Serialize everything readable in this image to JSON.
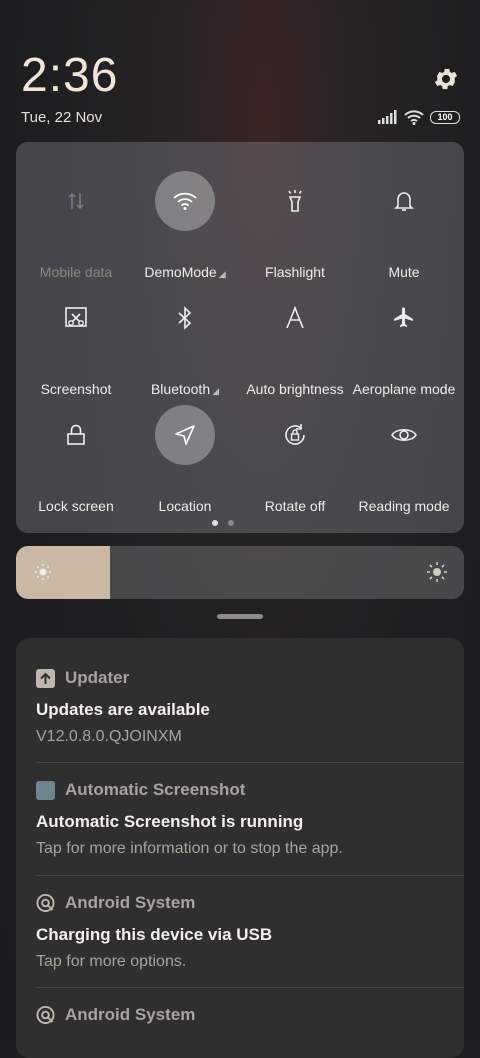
{
  "status": {
    "time": "2:36",
    "date": "Tue, 22 Nov",
    "battery": "100",
    "icons": [
      "signal-icon",
      "wifi-icon",
      "battery-icon",
      "gear-icon"
    ]
  },
  "quick_settings": {
    "tiles": [
      {
        "label": "Mobile data",
        "icon": "mobile-data-icon",
        "state": "off"
      },
      {
        "label": "DemoMode",
        "icon": "wifi-icon",
        "state": "on"
      },
      {
        "label": "Flashlight",
        "icon": "flashlight-icon",
        "state": "normal"
      },
      {
        "label": "Mute",
        "icon": "bell-icon",
        "state": "normal"
      },
      {
        "label": "Screenshot",
        "icon": "screenshot-icon",
        "state": "normal"
      },
      {
        "label": "Bluetooth",
        "icon": "bluetooth-icon",
        "state": "normal"
      },
      {
        "label": "Auto brightness",
        "icon": "auto-brightness-icon",
        "state": "normal"
      },
      {
        "label": "Aeroplane mode",
        "icon": "airplane-icon",
        "state": "normal"
      },
      {
        "label": "Lock screen",
        "icon": "lock-icon",
        "state": "normal"
      },
      {
        "label": "Location",
        "icon": "location-icon",
        "state": "on"
      },
      {
        "label": "Rotate off",
        "icon": "rotate-icon",
        "state": "normal"
      },
      {
        "label": "Reading mode",
        "icon": "eye-icon",
        "state": "normal"
      }
    ],
    "page_count": 2,
    "active_page": 1
  },
  "brightness": {
    "level_fraction": 0.21
  },
  "notifications": [
    {
      "app": "Updater",
      "title": "Updates are available",
      "text": "V12.0.8.0.QJOINXM",
      "icon": "upload-icon"
    },
    {
      "app": "Automatic Screenshot",
      "title": "Automatic Screenshot is running",
      "text": "Tap for more information or to stop the app.",
      "icon": "app-square-icon"
    },
    {
      "app": "Android System",
      "title": "Charging this device via USB",
      "text": "Tap for more options.",
      "icon": "android-system-icon"
    },
    {
      "app": "Android System",
      "title": "",
      "text": "",
      "icon": "android-system-icon"
    }
  ],
  "colors": {
    "accent_text": "#f5f1ea",
    "secondary_text": "#a8a39b",
    "brightness_fill": "#c9b9a4"
  }
}
